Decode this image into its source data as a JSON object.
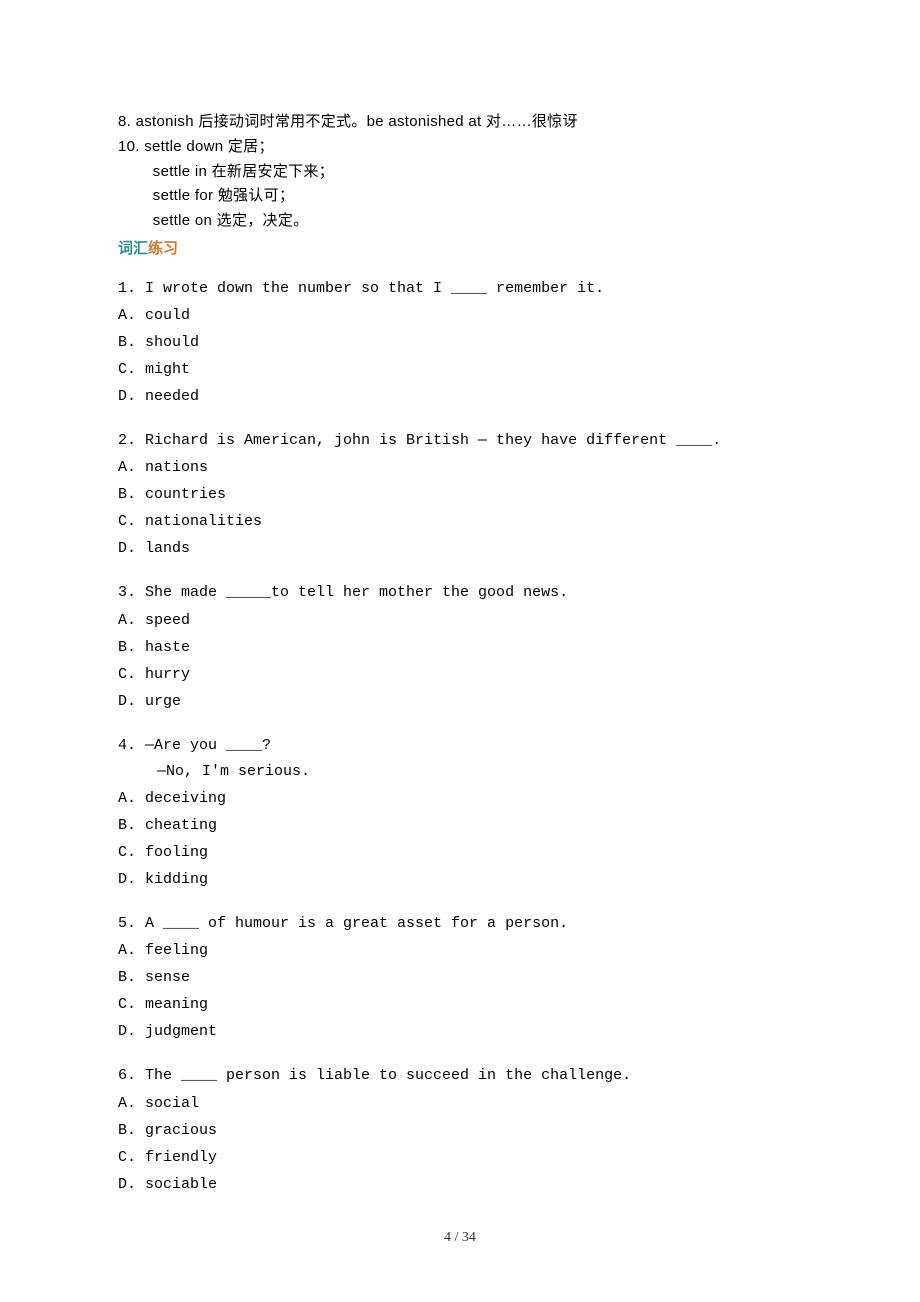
{
  "notes": {
    "n8": "8. astonish 后接动词时常用不定式。be astonished at 对……很惊讶",
    "n10": {
      "head": "10. settle down 定居；",
      "a": "　 settle in 在新居安定下来；",
      "b": "　 settle for 勉强认可；",
      "c": "　 settle on 选定，决定。"
    }
  },
  "section": {
    "left": "词汇",
    "right": "练习"
  },
  "questions": [
    {
      "stem": "1. I wrote down the number so that I ____ remember it.",
      "opts": [
        "A. could",
        "B. should",
        "C. might",
        "D. needed"
      ]
    },
    {
      "stem": "2. Richard is American, john is British — they have different ____.",
      "opts": [
        "A. nations",
        "B. countries",
        "C. nationalities",
        "D. lands"
      ]
    },
    {
      "stem": "3. She made _____to tell her mother the good news.",
      "opts": [
        "A. speed",
        "B. haste",
        "C. hurry",
        "D. urge"
      ]
    },
    {
      "stem": "4. —Are you ____?",
      "stem2": "　 —No, I'm serious.",
      "opts": [
        "A. deceiving",
        "B. cheating",
        "C. fooling",
        "D. kidding"
      ]
    },
    {
      "stem": "5. A ____ of humour is a great asset for a person.",
      "opts": [
        "A. feeling",
        "B. sense",
        "C. meaning",
        "D. judgment"
      ]
    },
    {
      "stem": "6. The ____ person is liable to succeed in the challenge.",
      "opts": [
        "A. social",
        "B. gracious",
        "C. friendly",
        "D. sociable"
      ]
    }
  ],
  "footer": {
    "pg": "4 / 34"
  }
}
